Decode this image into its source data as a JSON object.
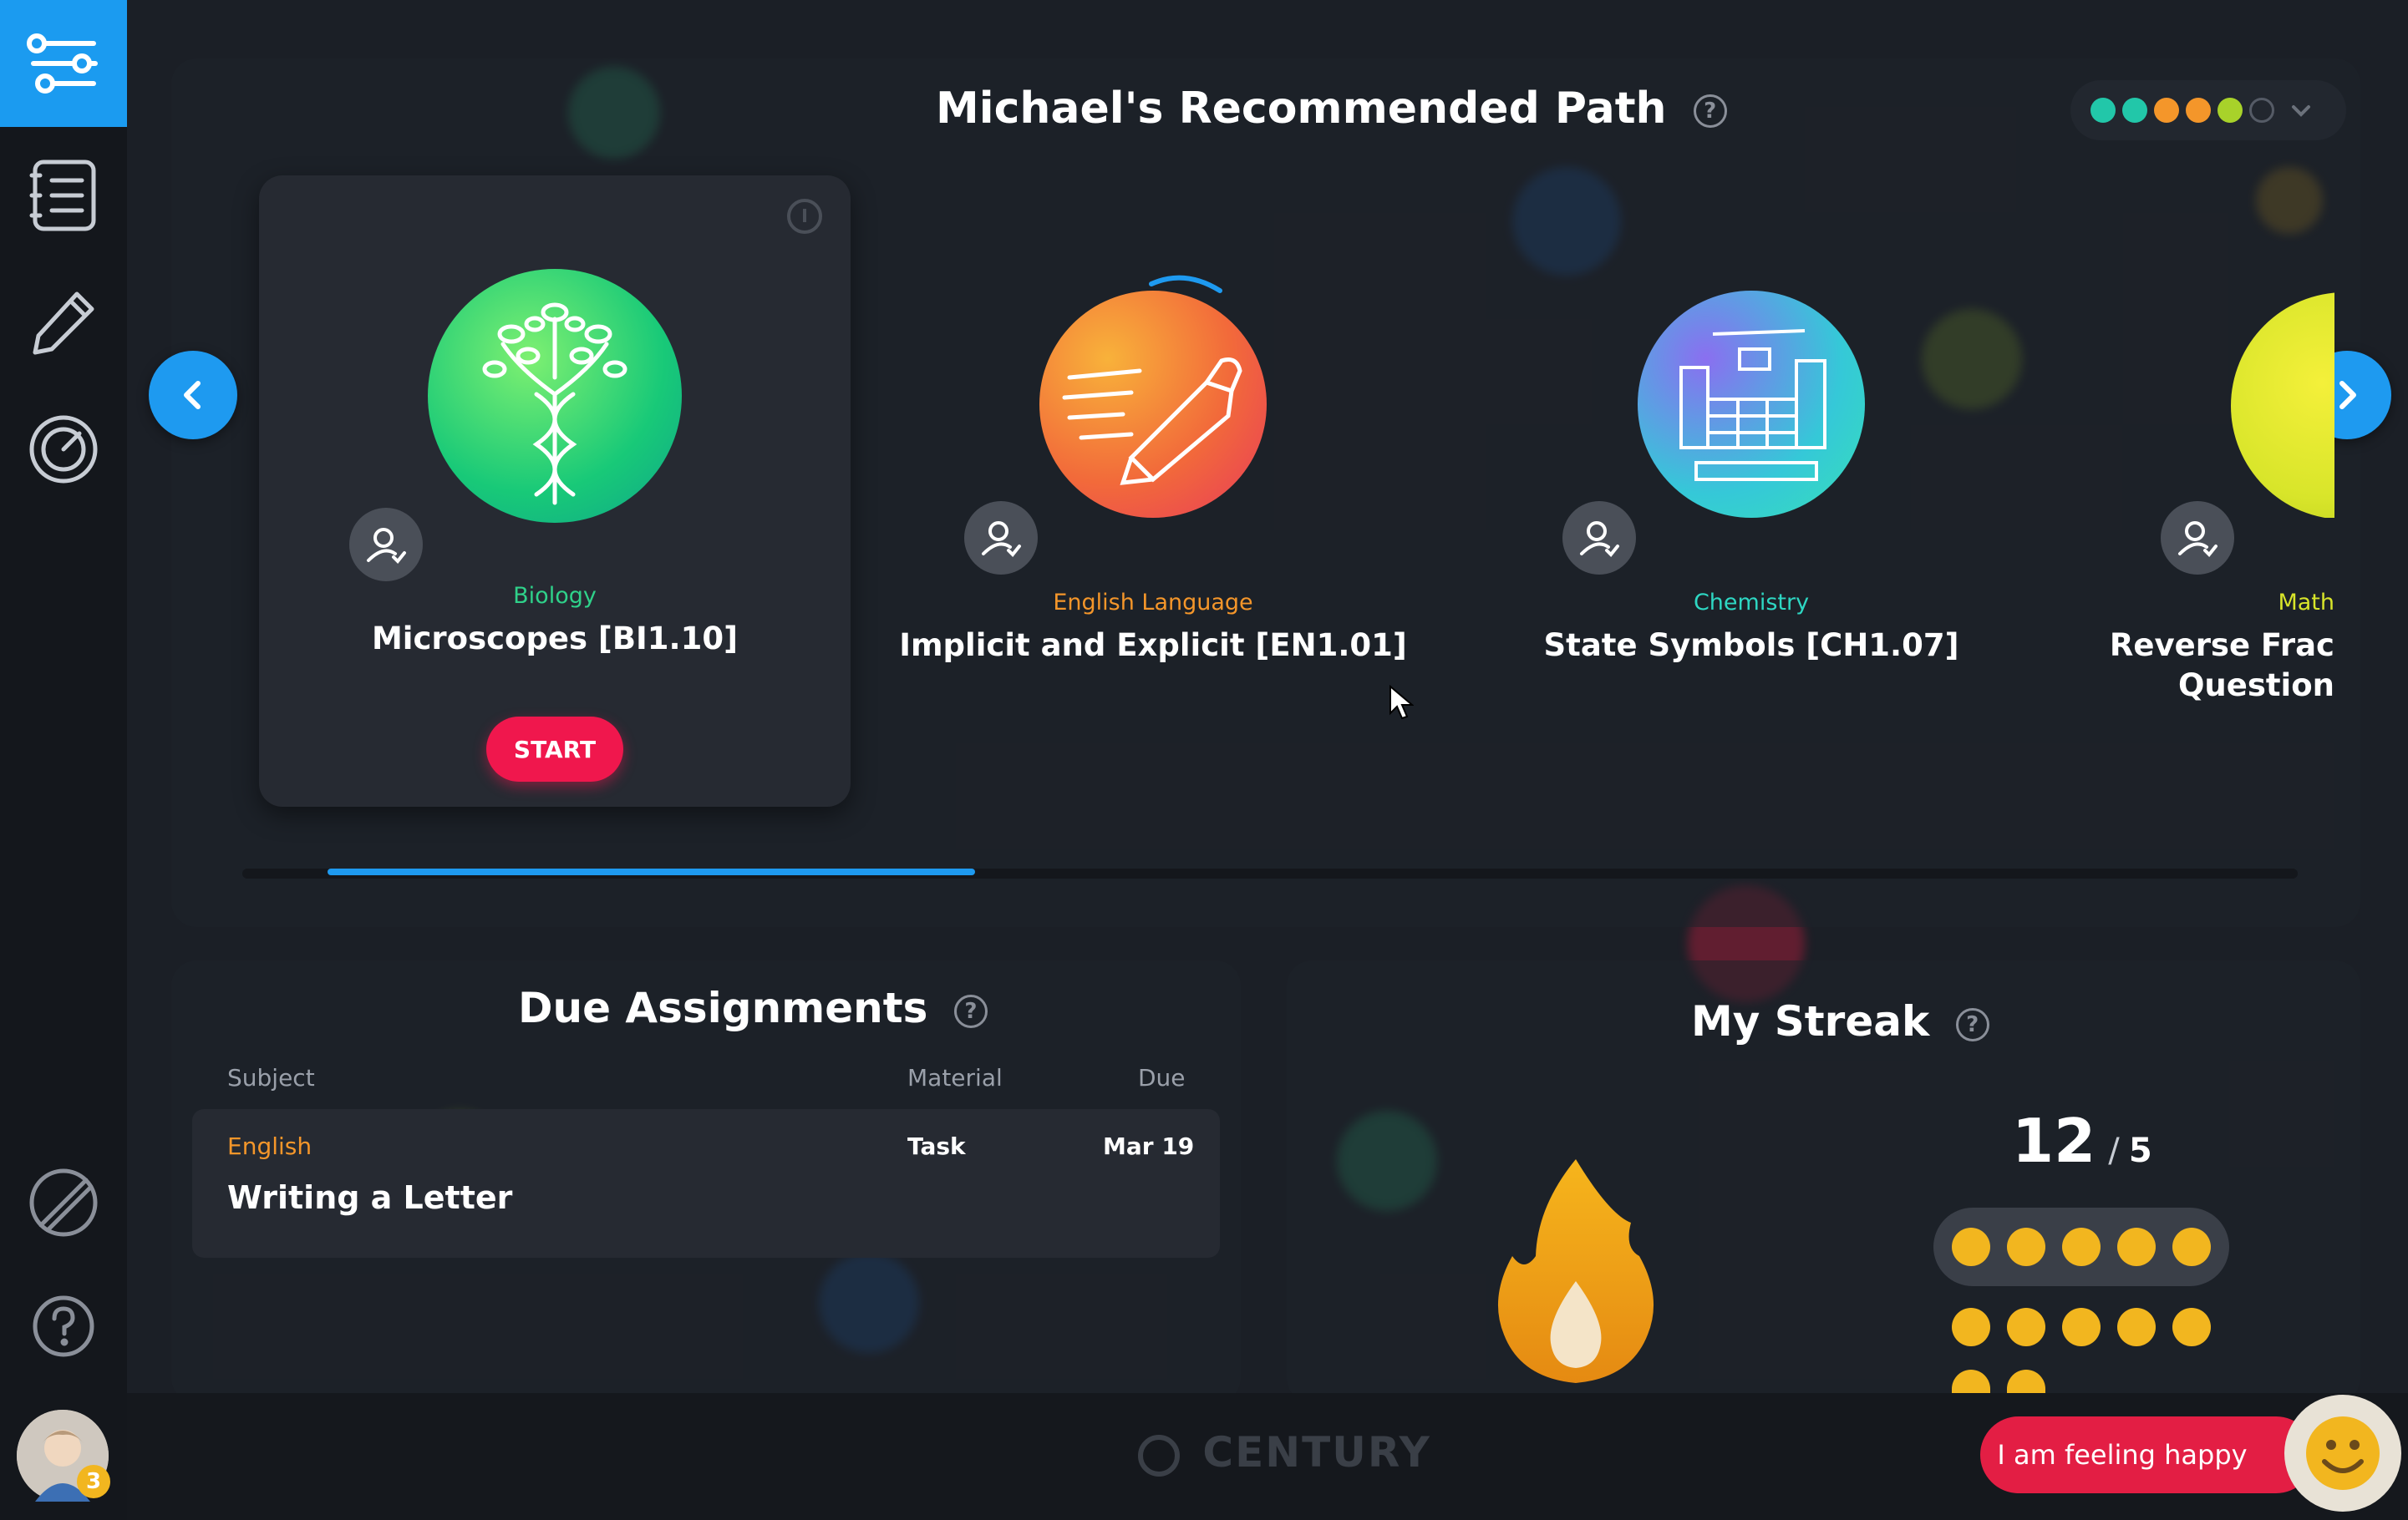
{
  "sidebar": {
    "items": [
      {
        "icon": "path-icon",
        "active": true
      },
      {
        "icon": "list-icon",
        "active": false
      },
      {
        "icon": "pencil-icon",
        "active": false
      },
      {
        "icon": "dashboard-icon",
        "active": false
      },
      {
        "icon": "no-pencil-icon",
        "active": false
      },
      {
        "icon": "help-icon",
        "active": false
      }
    ],
    "avatar_badge": "3"
  },
  "path": {
    "title": "Michael's Recommended Path",
    "help": "?",
    "difficulty_dots": [
      "#22c7a9",
      "#22c7a9",
      "#f4962a",
      "#f4962a",
      "#a8d22a"
    ],
    "progress_fraction": 0.3,
    "courses": [
      {
        "subject": "Biology",
        "title": "Microscopes [BI1.10]",
        "subject_color": "#2fd18a",
        "action": "START"
      },
      {
        "subject": "English Language",
        "title": "Implicit and Explicit [EN1.01]",
        "subject_color": "#f4962a"
      },
      {
        "subject": "Chemistry",
        "title": "State Symbols [CH1.07]",
        "subject_color": "#2ed7c3"
      },
      {
        "subject": "Math",
        "title": "Reverse Frac Question",
        "subject_color": "#d8e52a"
      }
    ]
  },
  "due": {
    "title": "Due Assignments",
    "help": "?",
    "headers": {
      "subject": "Subject",
      "material": "Material",
      "due": "Due"
    },
    "rows": [
      {
        "subject": "English",
        "name": "Writing a Letter",
        "material": "Task",
        "due": "Mar 19"
      }
    ]
  },
  "streak": {
    "title": "My Streak",
    "help": "?",
    "current": "12",
    "separator": "/",
    "goal": "5"
  },
  "footer": {
    "brand": "CENTURY",
    "mood_label": "I am feeling happy"
  }
}
